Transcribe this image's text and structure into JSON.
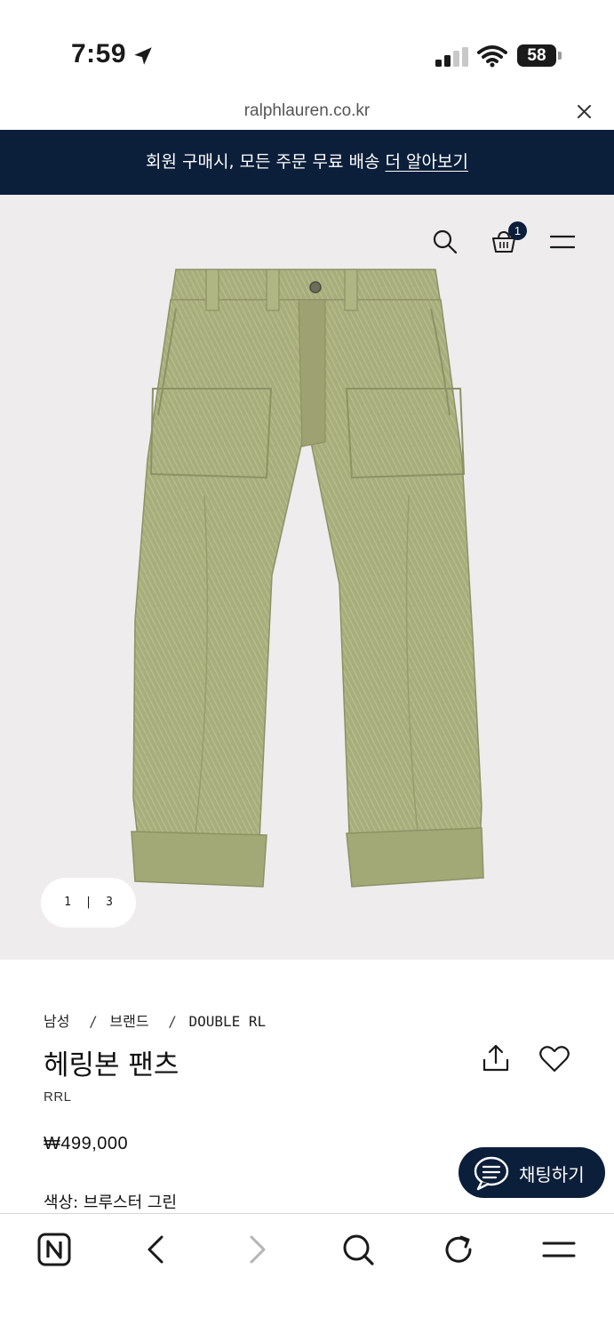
{
  "status_bar": {
    "time": "7:59",
    "battery": "58",
    "icons": [
      "location-arrow-icon",
      "cellular-signal-icon",
      "wifi-icon",
      "battery-icon"
    ]
  },
  "browser": {
    "url": "ralphlauren.co.kr",
    "close_icon": "close-icon"
  },
  "promo": {
    "text": "회원 구매시, 모든 주문 무료 배송",
    "link": "더 알아보기",
    "bg_color": "#0b1e3a"
  },
  "header": {
    "icons": [
      "search-icon",
      "shopping-bag-icon",
      "menu-icon"
    ],
    "cart_count": "1"
  },
  "gallery": {
    "current": "1",
    "separator": "|",
    "total": "3"
  },
  "product": {
    "breadcrumb": [
      "남성",
      "브랜드",
      "DOUBLE RL"
    ],
    "breadcrumb_sep": "/",
    "title": "헤링본 팬츠",
    "brand": "RRL",
    "price": "₩499,000",
    "color_label": "색상:",
    "color_value": "브루스터 그린"
  },
  "chat": {
    "label": "채팅하기"
  },
  "toolbar": {
    "icons": [
      "naver-home-icon",
      "back-icon",
      "forward-icon",
      "search-icon",
      "reload-icon",
      "menu-icon"
    ]
  }
}
